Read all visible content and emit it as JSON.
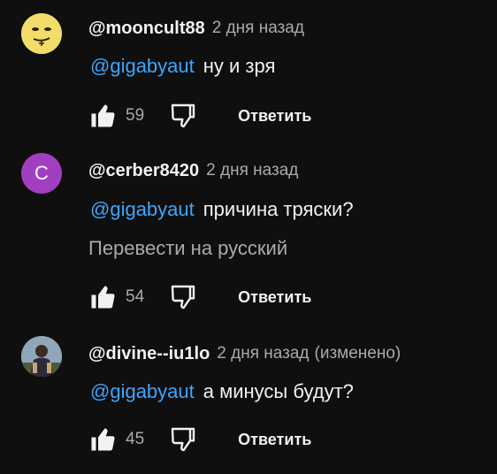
{
  "comments": [
    {
      "author": "@mooncult88",
      "time": "2 дня назад",
      "mention": "@gigabyaut",
      "text": "ну и зря",
      "likes": "59",
      "reply_label": "Ответить"
    },
    {
      "author": "@cerber8420",
      "time": "2 дня назад",
      "avatar_letter": "C",
      "avatar_color": "#a23fc1",
      "mention": "@gigabyaut",
      "text": "причина тряски?",
      "translate_label": "Перевести на русский",
      "likes": "54",
      "reply_label": "Ответить"
    },
    {
      "author": "@divine--iu1lo",
      "time": "2 дня назад",
      "edited": "(изменено)",
      "mention": "@gigabyaut",
      "text": "а минусы будут?",
      "likes": "45",
      "reply_label": "Ответить"
    }
  ],
  "colors": {
    "background": "#0f0f0f",
    "mention": "#3ea6ff",
    "secondary_text": "#aaaaaa"
  },
  "icons": [
    "thumbs-up-icon",
    "thumbs-down-icon"
  ]
}
